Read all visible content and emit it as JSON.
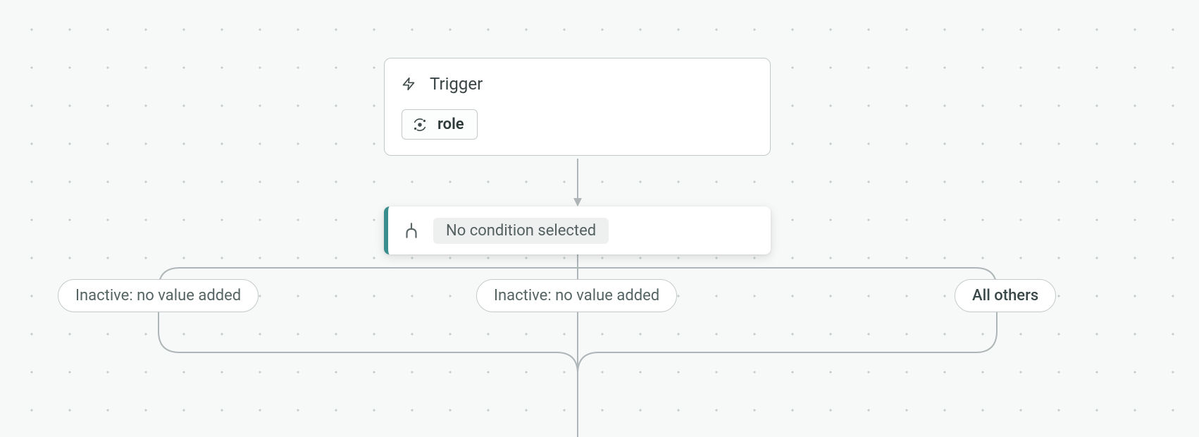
{
  "trigger": {
    "title": "Trigger",
    "chip_label": "role"
  },
  "condition": {
    "text": "No condition selected"
  },
  "branches": {
    "b1": "Inactive: no value added",
    "b2": "Inactive: no value added",
    "b3": "All others"
  }
}
